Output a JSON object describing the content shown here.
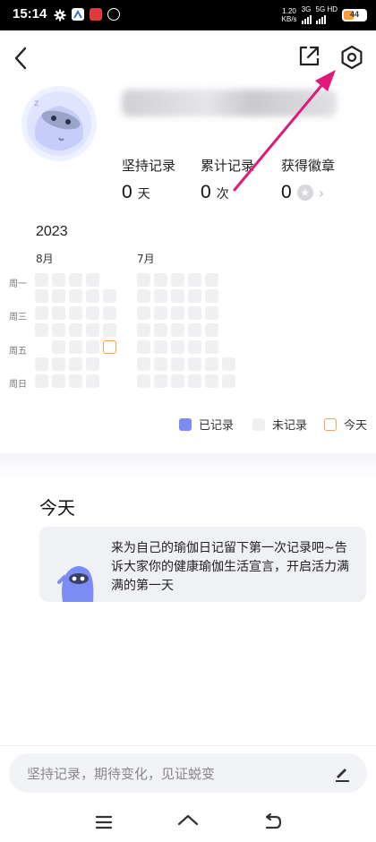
{
  "status_bar": {
    "time": "15:14",
    "speed_value": "1.20",
    "speed_unit": "KB/s",
    "net1": "3G",
    "net2": "5G HD",
    "battery": "44"
  },
  "header": {
    "back_icon": "chevron-left-icon",
    "share_icon": "share-export-icon",
    "settings_icon": "gear-icon"
  },
  "stats": [
    {
      "label": "坚持记录",
      "value": "0",
      "unit": "天"
    },
    {
      "label": "累计记录",
      "value": "0",
      "unit": "次"
    },
    {
      "label": "获得徽章",
      "value": "0",
      "unit": ""
    }
  ],
  "calendar": {
    "year": "2023",
    "months": [
      "8月",
      "7月"
    ],
    "weekdays": [
      "周一",
      "周三",
      "周五",
      "周日"
    ]
  },
  "legend": {
    "recorded": "已记录",
    "unrecorded": "未记录",
    "today": "今天"
  },
  "today": {
    "title": "今天",
    "message": "来为自己的瑜伽日记留下第一次记录吧~告诉大家你的健康瑜伽生活宣言，开启活力满满的第一天"
  },
  "composer": {
    "placeholder": "坚持记录，期待变化，见证蜕变"
  },
  "colors": {
    "accent": "#7b8cf5",
    "unrecorded": "#f0f0f3",
    "today": "#f0a25a",
    "arrow": "#e0197d"
  }
}
